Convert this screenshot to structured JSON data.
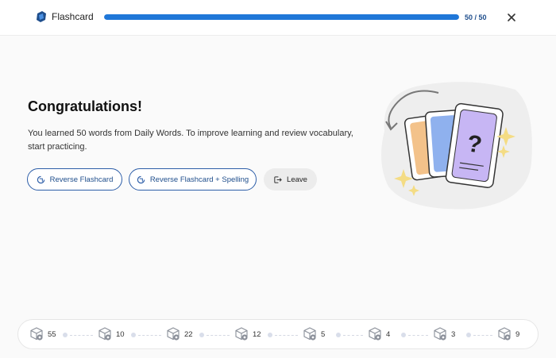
{
  "header": {
    "app_title": "Flashcard",
    "progress_text": "50 / 50",
    "progress_fraction": 1.0,
    "brand_color": "#1f77d8"
  },
  "main": {
    "heading": "Congratulations!",
    "message": "You learned 50 words from Daily Words. To improve learning and review vocabulary, start practicing.",
    "buttons": {
      "reverse_flashcard": "Reverse Flashcard",
      "reverse_flashcard_spelling": "Reverse Flashcard + Spelling",
      "leave": "Leave"
    }
  },
  "illustration": {
    "icon": "flashcards-question-illustration",
    "card_glyph": "?"
  },
  "levels": [
    {
      "icon": "box-level-0-icon",
      "count": "55"
    },
    {
      "icon": "box-level-1-icon",
      "count": "10"
    },
    {
      "icon": "box-level-2-icon",
      "count": "22"
    },
    {
      "icon": "box-level-3-icon",
      "count": "12"
    },
    {
      "icon": "box-level-4-icon",
      "count": "5"
    },
    {
      "icon": "box-level-5-icon",
      "count": "4"
    },
    {
      "icon": "box-level-6-icon",
      "count": "3"
    },
    {
      "icon": "box-level-done-icon",
      "count": "9"
    }
  ]
}
